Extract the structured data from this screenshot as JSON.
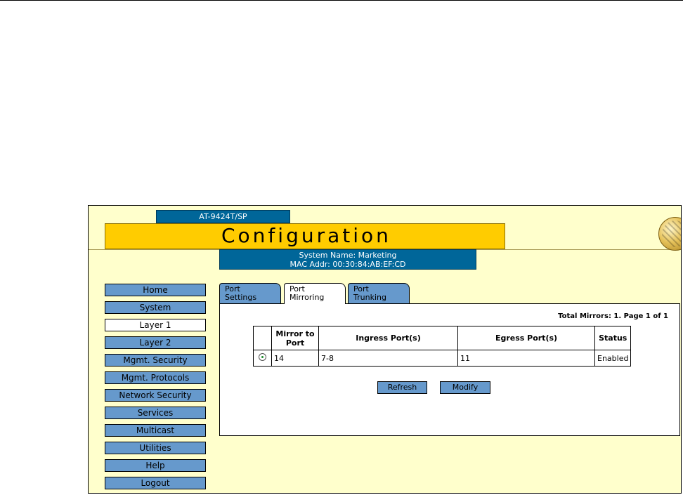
{
  "header": {
    "model": "AT-9424T/SP",
    "title": "Configuration",
    "system_name": "System Name: Marketing",
    "mac_addr": "MAC Addr: 00:30:84:AB:EF:CD"
  },
  "nav": {
    "items": [
      "Home",
      "System",
      "Layer 1",
      "Layer 2",
      "Mgmt. Security",
      "Mgmt. Protocols",
      "Network Security",
      "Services",
      "Multicast",
      "Utilities",
      "Help",
      "Logout"
    ],
    "active": "Layer 1"
  },
  "tabs": [
    {
      "line1": "Port",
      "line2": "Settings"
    },
    {
      "line1": "Port",
      "line2": "Mirroring",
      "active": true
    },
    {
      "line1": "Port",
      "line2": "Trunking"
    }
  ],
  "summary": "Total Mirrors: 1. Page 1 of 1",
  "table": {
    "headers": {
      "mirror_line1": "Mirror to",
      "mirror_line2": "Port",
      "ingress": "Ingress Port(s)",
      "egress": "Egress Port(s)",
      "status": "Status"
    },
    "rows": [
      {
        "selected": true,
        "mirror_port": "14",
        "ingress": "7-8",
        "egress": "11",
        "status": "Enabled"
      }
    ]
  },
  "buttons": {
    "refresh": "Refresh",
    "modify": "Modify"
  },
  "colors": {
    "page_bg": "#ffffcc",
    "banner": "#ffcc00",
    "dark_blue": "#006699",
    "button_blue": "#6699cc"
  }
}
